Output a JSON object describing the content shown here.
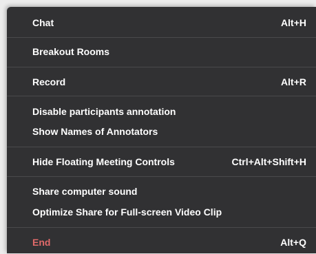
{
  "menu": {
    "items": [
      {
        "label": "Chat",
        "shortcut": "Alt+H"
      },
      {
        "label": "Breakout Rooms",
        "shortcut": ""
      },
      {
        "label": "Record",
        "shortcut": "Alt+R"
      },
      {
        "label": "Disable participants annotation",
        "shortcut": ""
      },
      {
        "label": "Show Names of Annotators",
        "shortcut": ""
      },
      {
        "label": "Hide Floating Meeting Controls",
        "shortcut": "Ctrl+Alt+Shift+H"
      },
      {
        "label": "Share computer sound",
        "shortcut": ""
      },
      {
        "label": "Optimize Share for Full-screen Video Clip",
        "shortcut": ""
      },
      {
        "label": "End",
        "shortcut": "Alt+Q"
      }
    ]
  },
  "colors": {
    "background": "#313133",
    "text": "#ffffff",
    "end_text": "#e06a6a",
    "separator": "#4a4a4c"
  }
}
